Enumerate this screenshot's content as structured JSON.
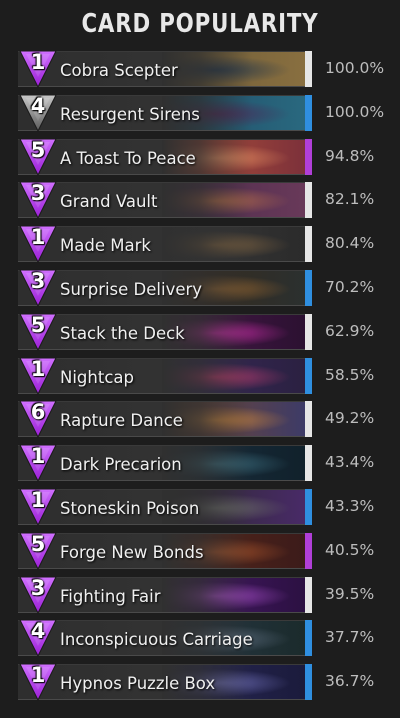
{
  "title": "CARD POPULARITY",
  "colors": {
    "background": "#1d1d1d",
    "mana_purple": "#9b1fd6",
    "neutral_stripe": "#e6e6e6",
    "blue_stripe": "#2f8fe0",
    "purple_stripe": "#b13fd8"
  },
  "cards": [
    {
      "cost": "1",
      "name": "Cobra Scepter",
      "popularity": "100.0%",
      "gem": "purple",
      "stripe": "neutral",
      "art": [
        "#6b5a38",
        "#2a3a4a",
        "#8a7040"
      ]
    },
    {
      "cost": "4",
      "name": "Resurgent Sirens",
      "popularity": "100.0%",
      "gem": "gray",
      "stripe": "blue",
      "art": [
        "#1f4a66",
        "#4a2d5a",
        "#2a6a80"
      ]
    },
    {
      "cost": "5",
      "name": "A Toast To Peace",
      "popularity": "94.8%",
      "gem": "purple",
      "stripe": "purple",
      "art": [
        "#b4553a",
        "#e08a60",
        "#7a2f3a"
      ]
    },
    {
      "cost": "3",
      "name": "Grand Vault",
      "popularity": "82.1%",
      "gem": "purple",
      "stripe": "neutral",
      "art": [
        "#4a2a4a",
        "#b06a4a",
        "#6a3a5a"
      ]
    },
    {
      "cost": "1",
      "name": "Made Mark",
      "popularity": "80.4%",
      "gem": "purple",
      "stripe": "neutral",
      "art": [
        "#3a3a3a",
        "#7a6040",
        "#2a2a2a"
      ]
    },
    {
      "cost": "3",
      "name": "Surprise Delivery",
      "popularity": "70.2%",
      "gem": "purple",
      "stripe": "blue",
      "art": [
        "#3a2a1a",
        "#8a6030",
        "#2a3030"
      ]
    },
    {
      "cost": "5",
      "name": "Stack the Deck",
      "popularity": "62.9%",
      "gem": "purple",
      "stripe": "neutral",
      "art": [
        "#4a1a4a",
        "#c02aa0",
        "#2a1030"
      ]
    },
    {
      "cost": "1",
      "name": "Nightcap",
      "popularity": "58.5%",
      "gem": "purple",
      "stripe": "blue",
      "art": [
        "#3a2a5a",
        "#b03a6a",
        "#2a2040"
      ]
    },
    {
      "cost": "6",
      "name": "Rapture Dance",
      "popularity": "49.2%",
      "gem": "purple",
      "stripe": "neutral",
      "art": [
        "#7a4a2a",
        "#c08040",
        "#3a3a6a"
      ]
    },
    {
      "cost": "1",
      "name": "Dark Precarion",
      "popularity": "43.4%",
      "gem": "purple",
      "stripe": "neutral",
      "art": [
        "#1a3040",
        "#3a6a7a",
        "#10202a"
      ]
    },
    {
      "cost": "1",
      "name": "Stoneskin Poison",
      "popularity": "43.3%",
      "gem": "purple",
      "stripe": "blue",
      "art": [
        "#2a2a2a",
        "#6a6a6a",
        "#4a2a6a"
      ]
    },
    {
      "cost": "5",
      "name": "Forge New Bonds",
      "popularity": "40.5%",
      "gem": "purple",
      "stripe": "purple",
      "art": [
        "#5a2a1a",
        "#a0502a",
        "#3a1a1a"
      ]
    },
    {
      "cost": "3",
      "name": "Fighting Fair",
      "popularity": "39.5%",
      "gem": "purple",
      "stripe": "neutral",
      "art": [
        "#4a1a6a",
        "#a04ac0",
        "#2a1040"
      ]
    },
    {
      "cost": "4",
      "name": "Inconspicuous Carriage",
      "popularity": "37.7%",
      "gem": "purple",
      "stripe": "blue",
      "art": [
        "#2a3a4a",
        "#5a6a7a",
        "#1a2a2a"
      ]
    },
    {
      "cost": "1",
      "name": "Hypnos Puzzle Box",
      "popularity": "36.7%",
      "gem": "purple",
      "stripe": "blue",
      "art": [
        "#2a2a5a",
        "#6a6ab0",
        "#1a1a3a"
      ]
    }
  ]
}
